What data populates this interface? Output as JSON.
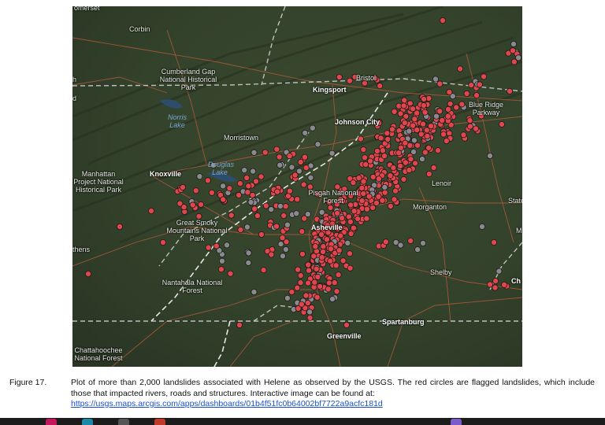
{
  "map": {
    "labels": {
      "somerset": "omerset",
      "corbin": "Corbin",
      "cumberland": "Cumberland Gap National Historical Park",
      "bristol": "Bristol",
      "kingsport": "Kingsport",
      "blue_ridge": "Blue Ridge Parkway",
      "norris": "Norris Lake",
      "johnson_city": "Johnson City",
      "morristown": "Morristown",
      "douglas": "Douglas Lake",
      "manhattan": "Manhattan Project National Historical Park",
      "knoxville": "Knoxville",
      "lenoir": "Lenoir",
      "pisgah": "Pisgah National Forest",
      "morganton": "Morganton",
      "state": "State",
      "smoky": "Great Smoky Mountains National Park",
      "asheville": "Asheville",
      "athens": "thens",
      "shelby": "Shelby",
      "ch": "Ch",
      "nantahala": "Nantahala National Forest",
      "spartanburg": "Spartanburg",
      "greenville": "Greenville",
      "chattahoochee": "Chattahoochee National Forest",
      "left_edge": "h",
      "left_edge2": "d",
      "m": "M"
    },
    "colors": {
      "flagged": "#e0464b",
      "unflagged": "#8a8a8e",
      "roads": "#b35a3a",
      "borders": "#d8d8d8"
    }
  },
  "caption": {
    "number": "Figure 17.",
    "text": "Plot of more than 2,000 landslides associated with Helene as observed by the USGS.  The red circles are flagged landslides, which include those that impacted rivers, roads and structures.   Interactive image can be found at:",
    "link": "https://usgs.maps.arcgis.com/apps/dashboards/01b4f51fc0b64002bf7722a9acfc181d"
  }
}
